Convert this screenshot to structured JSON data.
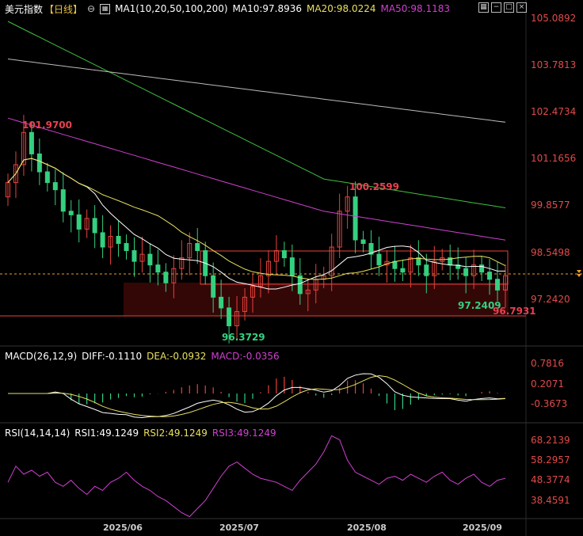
{
  "main": {
    "title": "美元指数",
    "period": "【日线】",
    "ma_params": "MA1(10,20,50,100,200)",
    "ma10": "MA10:97.8936",
    "ma20": "MA20:98.0224",
    "ma50": "MA50:98.1183",
    "price_axis": [
      "105.0892",
      "103.7813",
      "102.4734",
      "101.1656",
      "99.8577",
      "98.5498",
      "97.2420"
    ],
    "annotations": {
      "high1": "101.9700",
      "high2": "100.2599",
      "low1": "96.3729",
      "low2": "97.2409",
      "low3": "96.7931"
    }
  },
  "macd": {
    "label": "MACD(26,12,9)",
    "diff": "DIFF:-0.1110",
    "dea": "DEA:-0.0932",
    "macd": "MACD:-0.0356",
    "axis": [
      "0.7816",
      "0.2071",
      "-0.3673"
    ]
  },
  "rsi": {
    "label": "RSI(14,14,14)",
    "rsi1": "RSI1:49.1249",
    "rsi2": "RSI2:49.1249",
    "rsi3": "RSI3:49.1249",
    "axis": [
      "68.2139",
      "58.2957",
      "48.3774",
      "38.4591"
    ]
  },
  "x_axis": [
    "2025/06",
    "2025/07",
    "2025/08",
    "2025/09"
  ],
  "colors": {
    "up": "#e8423c",
    "down": "#35d07f",
    "ma10": "#ffffff",
    "ma20": "#e8e060",
    "ma50": "#d040d0",
    "ma100": "#40c040",
    "ma200": "#bbbbbb",
    "axis_text": "#e24a4a"
  },
  "chart_data": [
    {
      "type": "candlestick",
      "title": "美元指数【日线】",
      "series_names": [
        "MA10",
        "MA20",
        "MA50"
      ],
      "yticks": [
        105.0892,
        103.7813,
        102.4734,
        101.1656,
        99.8577,
        98.5498,
        97.242
      ],
      "xticks": [
        "2025/06",
        "2025/07",
        "2025/08",
        "2025/09"
      ],
      "close_approx": [
        100.5,
        101.0,
        101.9,
        101.3,
        100.8,
        100.5,
        100.3,
        99.7,
        99.6,
        99.2,
        99.5,
        99.1,
        98.7,
        99.0,
        98.8,
        98.6,
        98.3,
        98.5,
        98.2,
        98.0,
        97.7,
        98.1,
        98.4,
        98.8,
        98.6,
        97.9,
        97.3,
        97.0,
        96.5,
        96.9,
        97.3,
        97.6,
        97.9,
        98.3,
        98.6,
        98.4,
        97.9,
        97.4,
        97.5,
        97.8,
        97.9,
        98.7,
        99.7,
        100.1,
        98.9,
        98.8,
        98.5,
        98.2,
        98.3,
        98.1,
        98.0,
        98.4,
        98.2,
        97.9,
        98.3,
        98.4,
        98.2,
        98.1,
        97.9,
        98.2,
        98.0,
        97.8,
        97.5,
        97.9
      ]
    },
    {
      "type": "line",
      "title": "MACD(26,12,9)",
      "series_names": [
        "DIFF",
        "DEA",
        "MACD"
      ],
      "yticks": [
        0.7816,
        0.2071,
        -0.3673
      ],
      "last_values": {
        "DIFF": -0.111,
        "DEA": -0.0932,
        "MACD": -0.0356
      }
    },
    {
      "type": "line",
      "title": "RSI(14,14,14)",
      "series_names": [
        "RSI1",
        "RSI2",
        "RSI3"
      ],
      "yticks": [
        68.2139,
        58.2957,
        48.3774,
        38.4591
      ],
      "values": [
        47,
        55,
        51,
        53,
        50,
        52,
        47,
        45,
        48,
        44,
        41,
        45,
        43,
        47,
        49,
        52,
        48,
        45,
        43,
        40,
        38,
        35,
        32,
        30,
        34,
        38,
        44,
        50,
        55,
        57,
        54,
        51,
        49,
        48,
        47,
        45,
        43,
        48,
        52,
        56,
        62,
        70,
        68,
        58,
        52,
        50,
        48,
        46,
        49,
        50,
        48,
        51,
        49,
        47,
        50,
        52,
        48,
        46,
        49,
        51,
        47,
        45,
        48,
        49
      ]
    }
  ]
}
